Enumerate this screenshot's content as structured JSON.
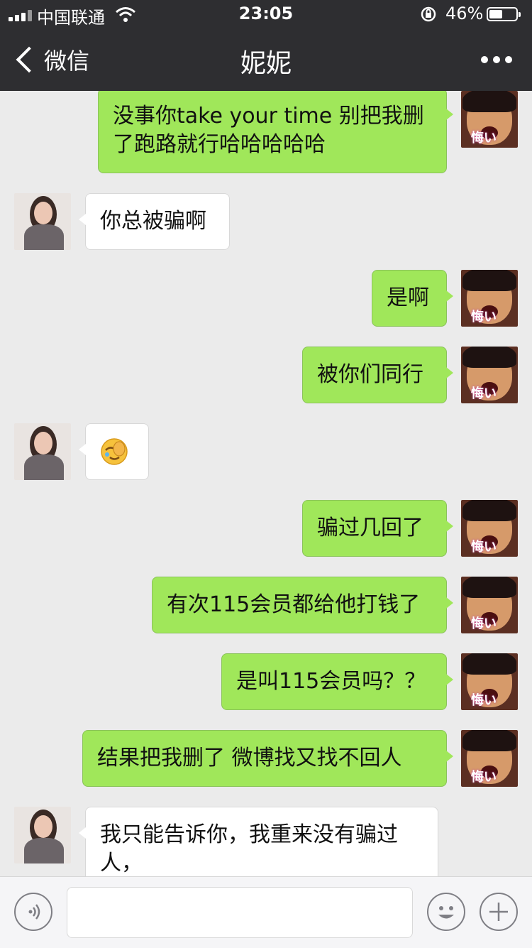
{
  "status_bar": {
    "carrier": "中国联通",
    "time": "23:05",
    "battery": "46%"
  },
  "nav": {
    "back_label": "微信",
    "title": "妮妮"
  },
  "messages": [
    {
      "from": "me",
      "text": "没事你take your time  别把我删了跑路就行哈哈哈哈哈"
    },
    {
      "from": "her",
      "text": "你总被骗啊"
    },
    {
      "from": "me",
      "text": "是啊"
    },
    {
      "from": "me",
      "text": "被你们同行"
    },
    {
      "from": "her",
      "emoji": "face-palm-crying-emoji"
    },
    {
      "from": "me",
      "text": "骗过几回了"
    },
    {
      "from": "me",
      "text": "有次115会员都给他打钱了"
    },
    {
      "from": "me",
      "text": "是叫115会员吗？？"
    },
    {
      "from": "me",
      "text": "结果把我删了  微博找又找不回人"
    },
    {
      "from": "her",
      "text": "我只能告诉你，我重来没有骗过人，"
    }
  ],
  "avatar_caption": "悔い",
  "input": {
    "placeholder": ""
  },
  "colors": {
    "nav_bg": "#2e2e31",
    "bubble_me": "#a0e75a",
    "bubble_her": "#ffffff",
    "chat_bg": "#ebebeb"
  }
}
